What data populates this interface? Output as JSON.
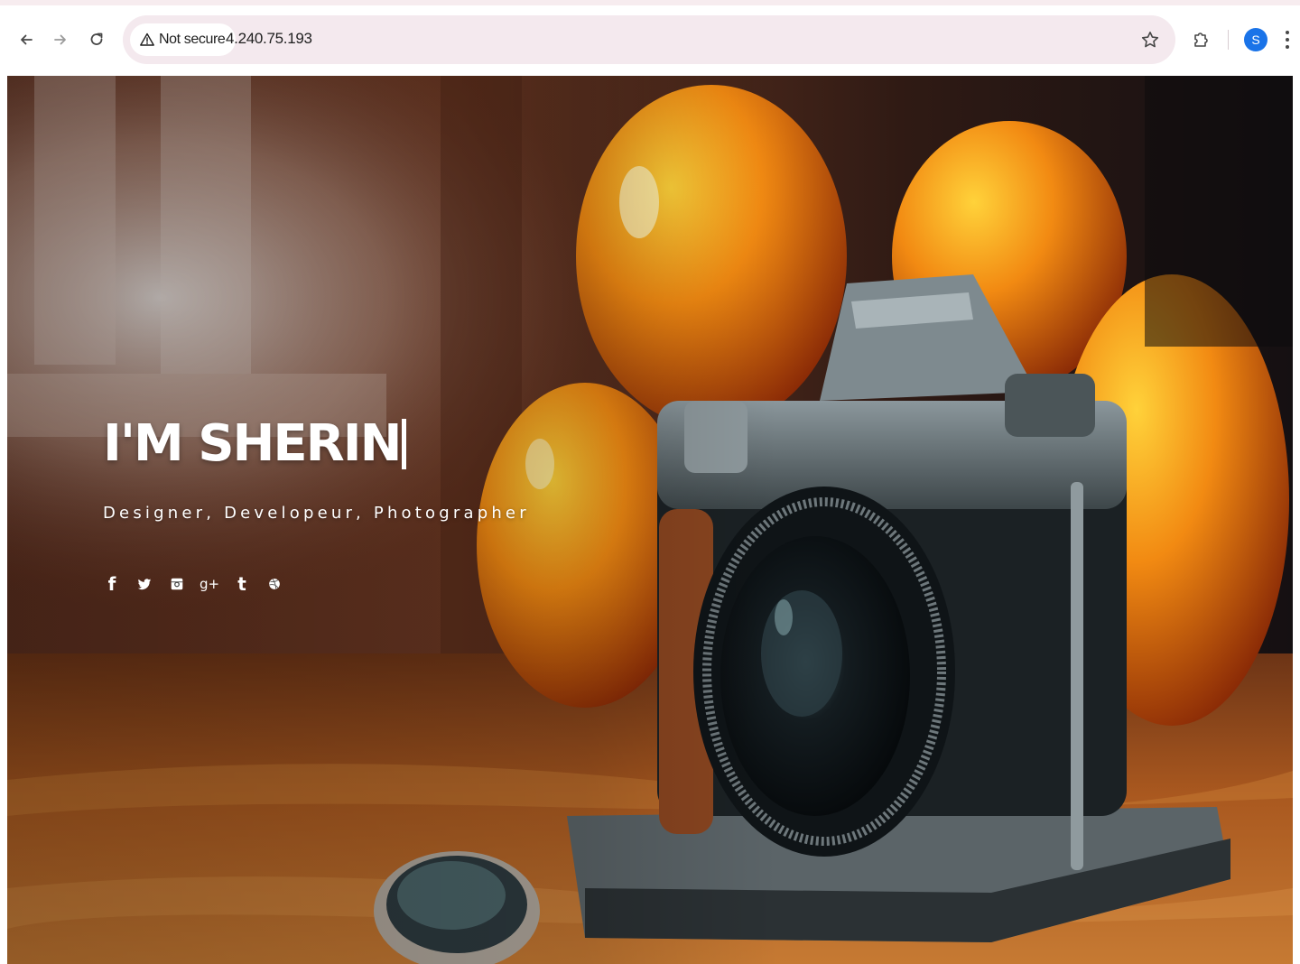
{
  "browser": {
    "security_label": "Not secure",
    "url": "4.240.75.193",
    "profile_initial": "S",
    "icons": {
      "back": "back-arrow-icon",
      "forward": "forward-arrow-icon",
      "reload": "reload-icon",
      "warning": "warning-triangle-icon",
      "bookmark": "star-icon",
      "extensions": "puzzle-icon",
      "menu": "kebab-menu-icon"
    },
    "colors": {
      "omnibox": "#f4e9ee",
      "avatar": "#1a73e8"
    }
  },
  "hero": {
    "title": "I'M SHERIN",
    "subtitle": "Designer, Developeur, Photographer",
    "social": [
      {
        "name": "facebook-icon",
        "glyph": "f"
      },
      {
        "name": "twitter-icon",
        "glyph": ""
      },
      {
        "name": "instagram-icon",
        "glyph": ""
      },
      {
        "name": "google-plus-icon",
        "glyph": "g+"
      },
      {
        "name": "tumblr-icon",
        "glyph": "t"
      },
      {
        "name": "dribbble-icon",
        "glyph": ""
      }
    ]
  }
}
